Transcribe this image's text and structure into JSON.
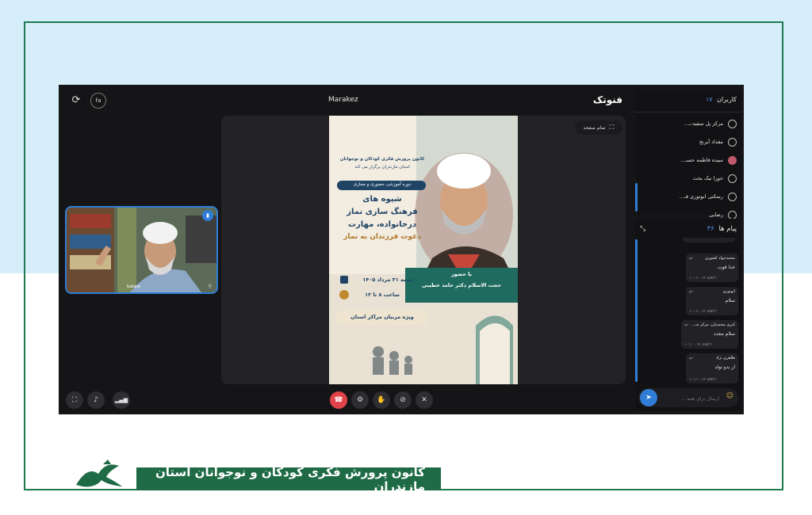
{
  "app": {
    "room_name": "Marakez",
    "brand": "فنوتک",
    "lang_badge": "fa"
  },
  "stage": {
    "fullscreen_label": "تمام صفحه"
  },
  "poster": {
    "org_line1": "کانون پرورش فکری کودکان و نوجوانان",
    "org_line2": "استان مازندران برگزار می کند",
    "course_type": "دوره آموزشی حضوری و مجازی",
    "title_line1": "شیوه های",
    "title_line2": "فرهنگ سازی نماز",
    "title_line3": "درخانواده، مهارت",
    "title_line4": "دعوت فرزندان به نماز",
    "date": "شنبه ۳۱ مرداد ۱۴۰۵",
    "time": "ساعت ۸ تا ۱۲",
    "audience": "ویژه مربیان مراکز استان",
    "presence_label": "با حضور",
    "speaker": "حجت الاسلام دکتر حامد خطیبی"
  },
  "participant": {
    "name": "babam"
  },
  "users_panel": {
    "title": "کاربران",
    "count": "۱۷",
    "users": [
      {
        "name": "مرکز پل سفید-ـ..."
      },
      {
        "name": "مقداد آیرنج"
      },
      {
        "name": "سیده فاطمه حسـ..."
      },
      {
        "name": "حورا نیک بخت"
      },
      {
        "name": "رسکنی ابوتوری قـ..."
      },
      {
        "name": "رضایی"
      }
    ]
  },
  "messages_panel": {
    "title": "پیام ها",
    "count": "۳۶",
    "messages": [
      {
        "name": "محمدجواد کشوری",
        "text": "خدا قوت",
        "date": "۱۴۰۵/۵/۳۱ - ۱۰:۰۷"
      },
      {
        "name": "ابوتوری",
        "text": "سلام",
        "date": "۱۴۰۵/۵/۳۱ - ۱۰:۰۸"
      },
      {
        "name": "کبری محمدیان، مرکز چـ...",
        "text": "سلام مجدد",
        "date": "۱۴۰۵/۵/۳۱ - ۱۰:۱۰"
      },
      {
        "name": "ظاهری نژاد",
        "text": "از بدو تولد",
        "date": "۱۴۰۵/۵/۳۱ - ۱۰:۱۱"
      }
    ],
    "input_placeholder": "ارسال برای همه ..."
  },
  "footer": {
    "banner_text": "کانون پرورش فکری کودکان و نوجوانان استان مازندران"
  },
  "colors": {
    "accent": "#2f7dd6",
    "hangup": "#e0444a",
    "banner": "#1f6b45"
  }
}
